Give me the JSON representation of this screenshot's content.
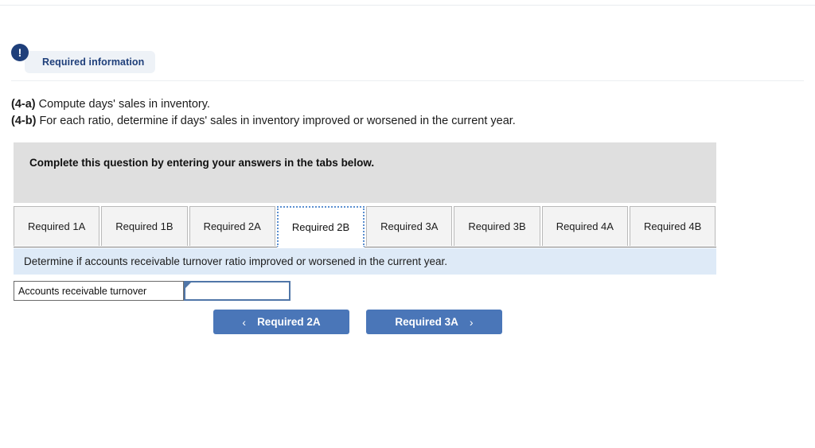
{
  "header": {
    "badge_icon": "exclamation-icon",
    "badge_label": "Required information"
  },
  "prompt": {
    "line1_tag": "(4-a)",
    "line1_text": " Compute days' sales in inventory.",
    "line2_tag": "(4-b)",
    "line2_text": " For each ratio, determine if days' sales in inventory improved or worsened in the current year."
  },
  "instruction": {
    "text": "Complete this question by entering your answers in the tabs below."
  },
  "tabs": [
    {
      "label": "Required 1A",
      "active": false
    },
    {
      "label": "Required 1B",
      "active": false
    },
    {
      "label": "Required 2A",
      "active": false
    },
    {
      "label": "Required 2B",
      "active": true
    },
    {
      "label": "Required 3A",
      "active": false
    },
    {
      "label": "Required 3B",
      "active": false
    },
    {
      "label": "Required 4A",
      "active": false
    },
    {
      "label": "Required 4B",
      "active": false
    }
  ],
  "sub_instruction": {
    "text": "Determine if accounts receivable turnover ratio improved or worsened in the current year."
  },
  "answer_row": {
    "label": "Accounts receivable turnover",
    "value": "",
    "placeholder": ""
  },
  "navigation": {
    "prev_label": "Required 2A",
    "prev_icon": "chevron-left-icon",
    "next_label": "Required 3A",
    "next_icon": "chevron-right-icon"
  },
  "colors": {
    "button_blue": "#4a76b8",
    "badge_navy": "#1f3f7a",
    "badge_bg": "#eef2f7",
    "panel_gray": "#dfdfdf",
    "sub_bar_blue": "#deeaf7",
    "focus_blue": "#5b8fd0",
    "cell_border_blue": "#5076a8"
  }
}
